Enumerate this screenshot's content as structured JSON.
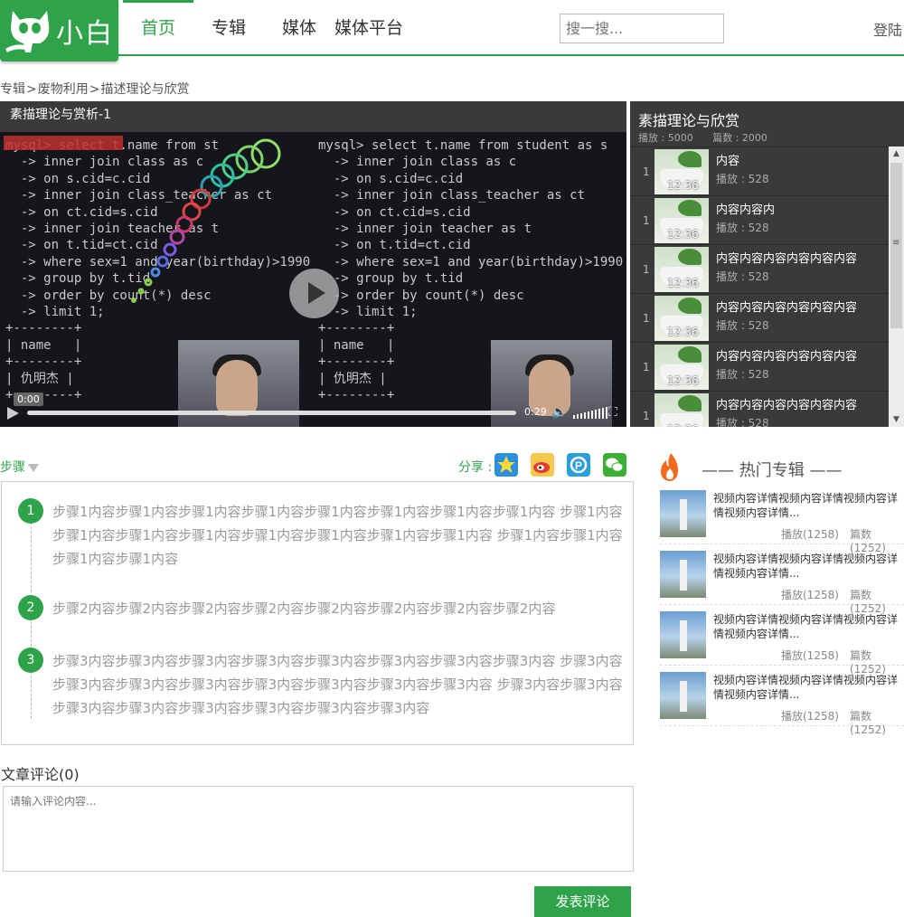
{
  "header": {
    "brand": "小白",
    "nav": [
      "首页",
      "专辑",
      "媒体",
      "媒体平台"
    ],
    "search_placeholder": "搜一搜...",
    "login": "登陆",
    "accent_color": "#2fa34a"
  },
  "breadcrumb": [
    "专辑",
    "废物利用",
    "描述理论与欣赏"
  ],
  "player": {
    "title": "素描理论与赏析-1",
    "current_time": "0:00",
    "duration": "0:29",
    "progress": 0,
    "screen_code_left": [
      "mysql> select t.name from st",
      "  -> inner join class as c",
      "  -> on s.cid=c.cid",
      "  -> inner join class_teacher as ct",
      "  -> on ct.cid=s.cid",
      "  -> inner join teacher as t",
      "  -> on t.tid=ct.cid",
      "  -> where sex=1 and year(birthday)>1990",
      "  -> group by t.tid",
      "  -> order by count(*) desc",
      "  -> limit 1;",
      "+--------+",
      "| name   |",
      "+--------+",
      "| 仇明杰 |",
      "+--------+"
    ],
    "screen_code_right": [
      "mysql> select t.name from student as s",
      "  -> inner join class as c",
      "  -> on s.cid=c.cid",
      "  -> inner join class_teacher as ct",
      "  -> on ct.cid=s.cid",
      "  -> inner join teacher as t",
      "  -> on t.tid=ct.cid",
      "  -> where sex=1 and year(birthday)>1990",
      "  -> group by t.tid",
      "  -> order by count(*) desc",
      "  -> limit 1;",
      "+--------+",
      "| name   |",
      "+--------+",
      "| 仇明杰 |",
      "+--------+"
    ]
  },
  "playlist": {
    "title": "素描理论与欣赏",
    "plays_label": "播放 : 5000",
    "count_label": "篇数 : 2000",
    "items": [
      {
        "num": "1",
        "name": "内容",
        "duration": "12:36",
        "plays": "播放 : 528"
      },
      {
        "num": "1",
        "name": "内容内容内",
        "duration": "12:36",
        "plays": "播放 : 528"
      },
      {
        "num": "1",
        "name": "内容内容内容内容内容内容",
        "duration": "12:36",
        "plays": "播放 : 528"
      },
      {
        "num": "1",
        "name": "内容内容内容内容内容内容",
        "duration": "12:36",
        "plays": "播放 : 528"
      },
      {
        "num": "1",
        "name": "内容内容内容内容内容内容",
        "duration": "12:36",
        "plays": "播放 : 528"
      },
      {
        "num": "1",
        "name": "内容内容内容内容内容内容",
        "duration": "12:36",
        "plays": "播放 : 528"
      }
    ]
  },
  "steps": {
    "label": "步骤",
    "share_label": "分享 :",
    "items": [
      {
        "num": "1",
        "text": "步骤1内容步骤1内容步骤1内容步骤1内容步骤1内容步骤1内容步骤1内容步骤1内容 步骤1内容步骤1内容步骤1内容步骤1内容步骤1内容步骤1内容步骤1内容步骤1内容 步骤1内容步骤1内容步骤1内容步骤1内容"
      },
      {
        "num": "2",
        "text": "步骤2内容步骤2内容步骤2内容步骤2内容步骤2内容步骤2内容步骤2内容步骤2内容"
      },
      {
        "num": "3",
        "text": "步骤3内容步骤3内容步骤3内容步骤3内容步骤3内容步骤3内容步骤3内容步骤3内容 步骤3内容步骤3内容步骤3内容步骤3内容步骤3内容步骤3内容步骤3内容步骤3内容 步骤3内容步骤3内容步骤3内容步骤3内容步骤3内容步骤3内容步骤3内容步骤3内容"
      }
    ]
  },
  "hot": {
    "title": "—— 热门专辑 ——",
    "items": [
      {
        "text": "视频内容详情视频内容详情视频内容详情视频内容详情...",
        "plays": "播放(1258)",
        "count": "篇数(1252)"
      },
      {
        "text": "视频内容详情视频内容详情视频内容详情视频内容详情...",
        "plays": "播放(1258)",
        "count": "篇数(1252)"
      },
      {
        "text": "视频内容详情视频内容详情视频内容详情视频内容详情...",
        "plays": "播放(1258)",
        "count": "篇数(1252)"
      },
      {
        "text": "视频内容详情视频内容详情视频内容详情视频内容详情...",
        "plays": "播放(1258)",
        "count": "篇数(1252)"
      }
    ]
  },
  "comments": {
    "title": "文章评论(0)",
    "placeholder": "请输入评论内容...",
    "submit": "发表评论"
  }
}
